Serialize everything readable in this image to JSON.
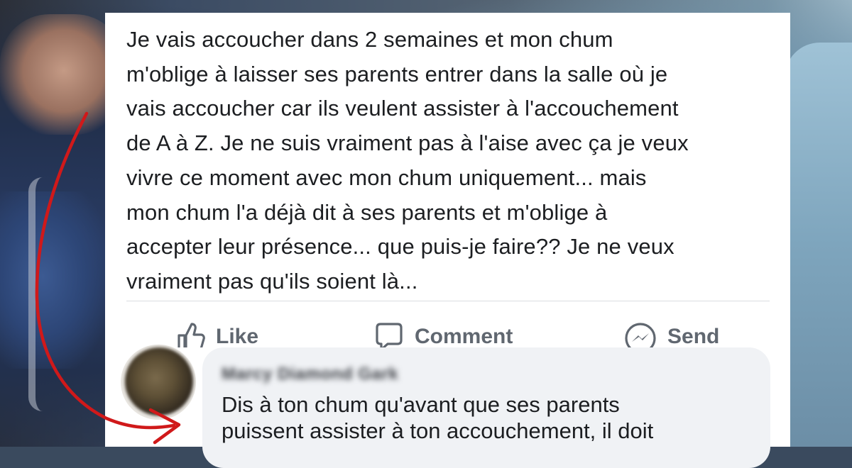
{
  "post": {
    "text": "Je vais accoucher dans 2 semaines et mon chum\nm'oblige à laisser ses parents entrer dans la salle où je\nvais accoucher car ils veulent assister à l'accouchement\nde A à Z.  Je ne suis vraiment pas à l'aise avec ça je veux\nvivre ce moment avec mon chum uniquement... mais\nmon chum l'a déjà dit à ses parents et m'oblige à\naccepter leur présence... que puis-je faire?? Je ne veux\nvraiment pas qu'ils soient là..."
  },
  "actions": {
    "like": {
      "label": "Like",
      "icon": "thumbs-up-icon"
    },
    "comment": {
      "label": "Comment",
      "icon": "comment-bubble-icon"
    },
    "send": {
      "label": "Send",
      "icon": "messenger-icon"
    }
  },
  "comment": {
    "author": "Marcy Diamond Gark",
    "text": "Dis à ton chum qu'avant que ses parents\npuissent assister à ton accouchement, il doit"
  },
  "colors": {
    "card": "#ffffff",
    "bubble": "#f0f2f5",
    "arrow": "#d0191a",
    "text": "#1c1e21",
    "action_text": "#606770"
  }
}
